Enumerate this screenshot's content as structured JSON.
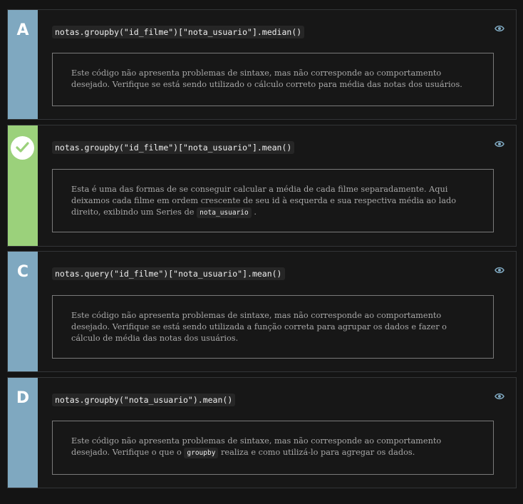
{
  "options": [
    {
      "letter": "A",
      "code": "notas.groupby(\"id_filme\")[\"nota_usuario\"].median()",
      "feedback": "Este código não apresenta problemas de sintaxe, mas não corresponde ao comportamento desejado. Verifique se está sendo utilizado o cálculo correto para média das notas dos usuários."
    },
    {
      "letter": "",
      "correct": true,
      "code": "notas.groupby(\"id_filme\")[\"nota_usuario\"].mean()",
      "feedback_before": "Esta é uma das formas de se conseguir calcular a média de cada filme separadamente. Aqui deixamos cada filme em ordem crescente de seu id à esquerda e sua respectiva média ao lado direito, exibindo um Series de",
      "feedback_code": "nota_usuario",
      "feedback_after": "."
    },
    {
      "letter": "C",
      "code": "notas.query(\"id_filme\")[\"nota_usuario\"].mean()",
      "feedback": "Este código não apresenta problemas de sintaxe, mas não corresponde ao comportamento desejado. Verifique se está sendo utilizada a função correta para agrupar os dados e fazer o cálculo de média das notas dos usuários."
    },
    {
      "letter": "D",
      "code": "notas.groupby(\"nota_usuario\").mean()",
      "feedback_before": "Este código não apresenta problemas de sintaxe, mas não corresponde ao comportamento desejado. Verifique o que o",
      "feedback_code": "groupby",
      "feedback_after": "realiza e como utilizá-lo para agregar os dados."
    }
  ],
  "icons": {
    "view": "eye-icon",
    "correct": "checkmark-icon"
  },
  "colors": {
    "option_bar": "#7fa8c0",
    "correct_bar": "#9bd17b",
    "background": "#141414"
  }
}
